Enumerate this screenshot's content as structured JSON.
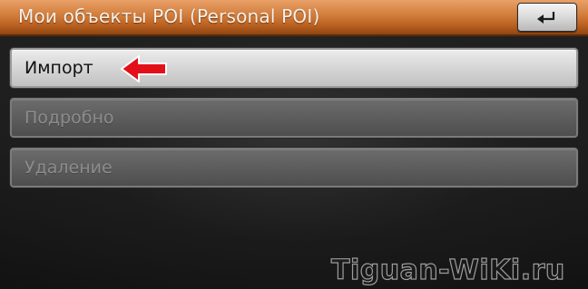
{
  "header": {
    "title": "Мои объекты POI (Personal POI)",
    "back_icon": "return-arrow-icon"
  },
  "menu": {
    "items": [
      {
        "label": "Импорт",
        "enabled": true
      },
      {
        "label": "Подробно",
        "enabled": false
      },
      {
        "label": "Удаление",
        "enabled": false
      }
    ]
  },
  "annotation": {
    "arrow_icon": "red-arrow-left-icon",
    "arrow_color": "#e3101a"
  },
  "watermark": {
    "text": "Tiguan-WiKi.ru"
  },
  "colors": {
    "header_accent": "#d17c3a",
    "active_item": "#dcdcdc",
    "disabled_item": "#5d5d5d"
  }
}
